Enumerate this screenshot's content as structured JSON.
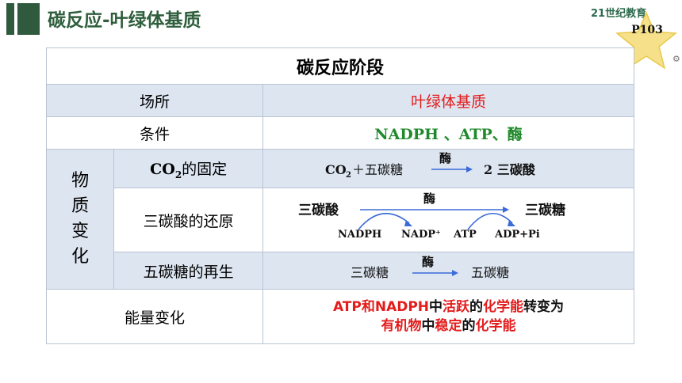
{
  "header": {
    "title": "碳反应-叶绿体基质",
    "logo_text": "21世纪教育",
    "page_tag": "P103"
  },
  "table": {
    "heading": "碳反应阶段",
    "rows": [
      {
        "label": "场所",
        "value": "叶绿体基质"
      },
      {
        "label": "条件",
        "value": "NADPH 、ATP、酶"
      }
    ],
    "material_change_label": "物质变化",
    "sub_rows": [
      {
        "label_main": "CO",
        "label_sub": "2",
        "label_rest": "的固定"
      },
      {
        "label": "三碳酸的还原"
      },
      {
        "label": "五碳糖的再生"
      }
    ],
    "energy_label": "能量变化"
  },
  "reactions": {
    "fixation": {
      "left_main": "CO",
      "left_sub": "2",
      "left_rest": "＋五碳糖",
      "enzyme": "酶",
      "right": "2 三碳酸"
    },
    "reduction": {
      "left": "三碳酸",
      "enzyme": "酶",
      "right": "三碳糖",
      "nadph": "NADPH",
      "nadp": "NADP⁺",
      "atp": "ATP",
      "adp": "ADP+Pi"
    },
    "regeneration": {
      "left": "三碳糖",
      "enzyme": "酶",
      "right": "五碳糖"
    }
  },
  "energy": {
    "line1_parts": [
      {
        "text": "ATP和NADPH",
        "color": "red"
      },
      {
        "text": "中",
        "color": "black"
      },
      {
        "text": "活跃",
        "color": "red"
      },
      {
        "text": "的",
        "color": "black"
      },
      {
        "text": "化学能",
        "color": "red"
      },
      {
        "text": "转变为",
        "color": "black"
      }
    ],
    "line2_parts": [
      {
        "text": "有机物",
        "color": "red"
      },
      {
        "text": "中",
        "color": "black"
      },
      {
        "text": "稳定",
        "color": "red"
      },
      {
        "text": "的",
        "color": "black"
      },
      {
        "text": "化学能",
        "color": "red"
      }
    ]
  },
  "colors": {
    "accent_green": "#2e5e3c",
    "highlight_red": "#e31c1c",
    "condition_green": "#1f8a2b",
    "row_blue": "#dde5f1"
  }
}
